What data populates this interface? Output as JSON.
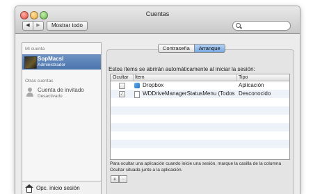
{
  "window": {
    "title": "Cuentas"
  },
  "toolbar": {
    "back_label": "◀",
    "forward_label": "▶",
    "show_all_label": "Mostrar todo",
    "search_placeholder": ""
  },
  "sidebar": {
    "my_account_header": "Mi cuenta",
    "current_user": {
      "name": "SopMacsI",
      "role": "Administrador"
    },
    "other_accounts_header": "Otras cuentas",
    "guest": {
      "name": "Cuenta de invitado",
      "status": "Desactivado"
    },
    "footer_label": "Opc. inicio sesión"
  },
  "tabs": [
    {
      "label": "Contraseña",
      "active": false
    },
    {
      "label": "Arranque",
      "active": true
    }
  ],
  "startup": {
    "intro": "Estos ítems se abrirán automáticamente al iniciar la sesión:",
    "columns": {
      "hide": "Ocultar",
      "item": "Ítem",
      "type": "Tipo"
    },
    "rows": [
      {
        "hide": false,
        "icon": "dropbox-icon",
        "item": "Dropbox",
        "type": "Aplicación"
      },
      {
        "hide": true,
        "icon": "document-icon",
        "item": "WDDriveManagerStatusMenu (Todos",
        "type": "Desconocido"
      }
    ],
    "footnote": "Para ocultar una aplicación cuando inicie una sesión, marque la casilla de la columna Ocultar situada junto a la aplicación.",
    "add_label": "+",
    "remove_label": "−"
  },
  "colors": {
    "selection": "#5a80b6",
    "tab_active": "#8ab4e6"
  }
}
